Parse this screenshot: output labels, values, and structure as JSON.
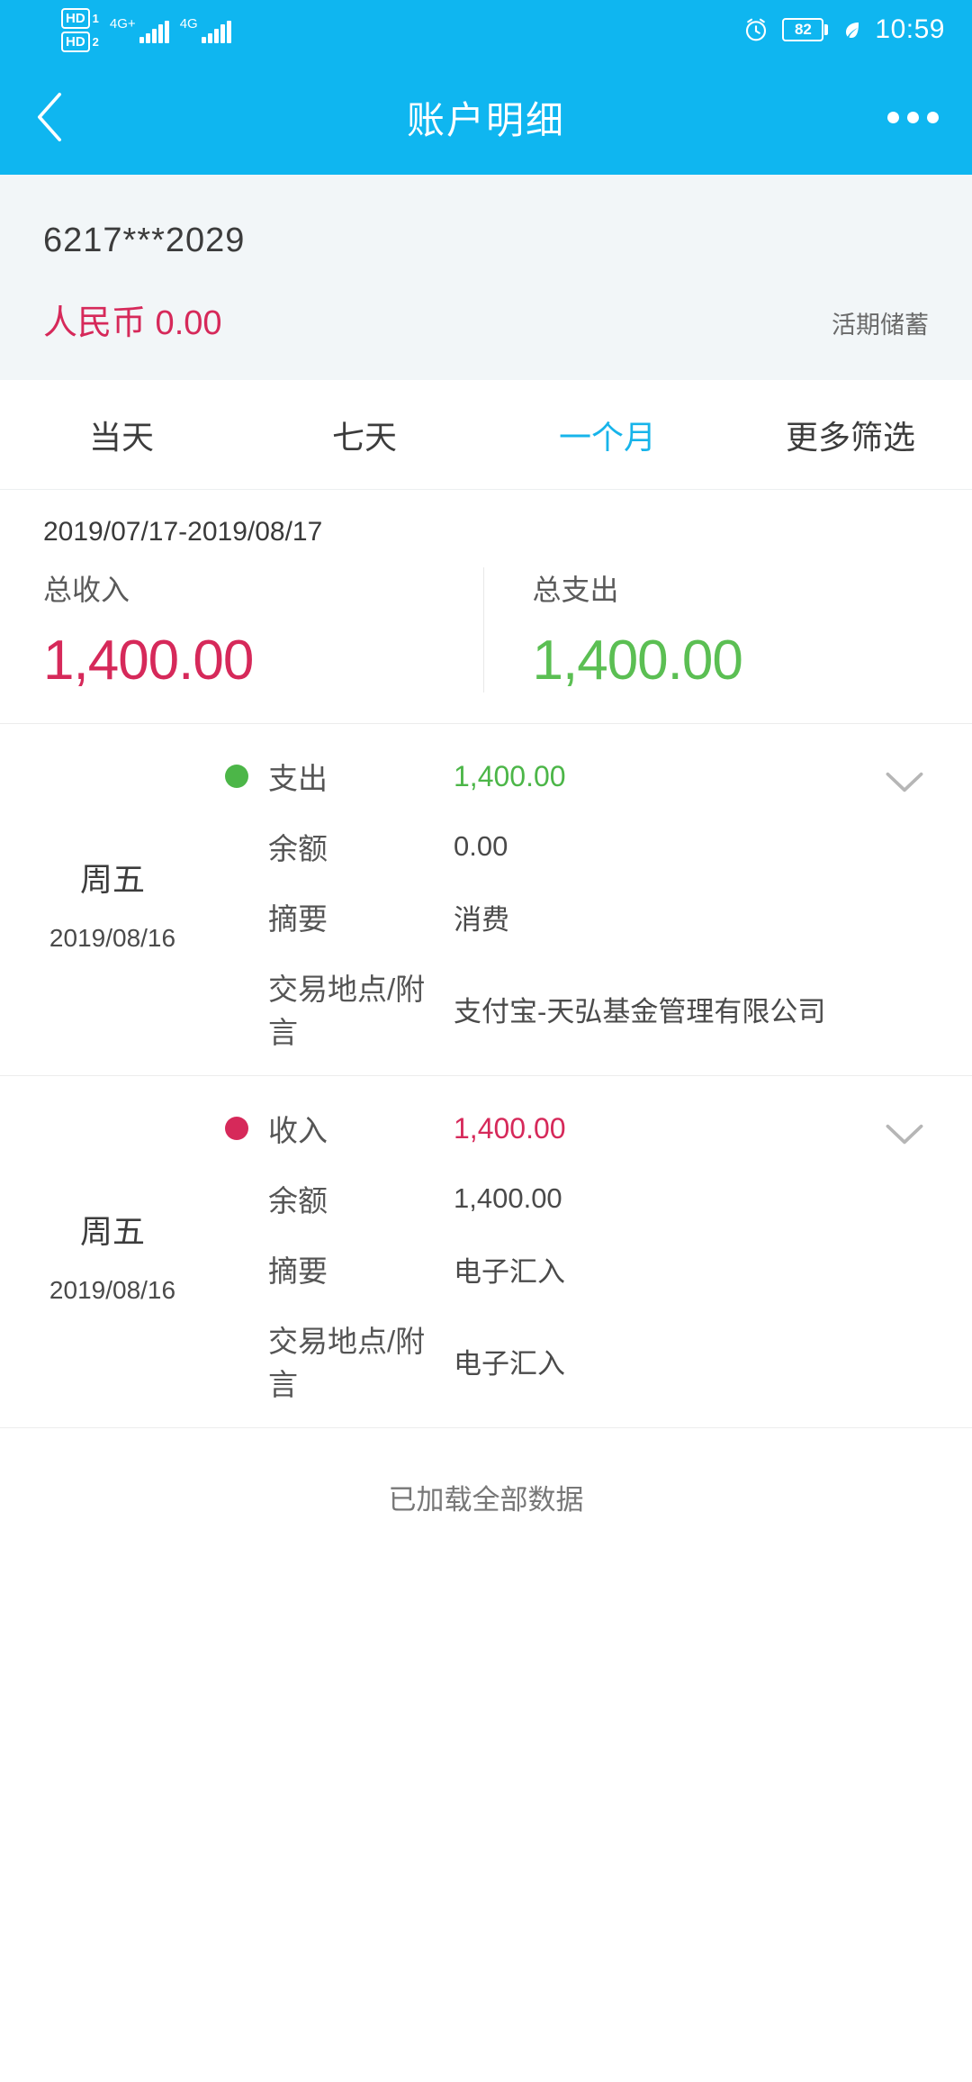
{
  "status_bar": {
    "sim1_hd": "HD",
    "sim1_index": "1",
    "sim2_hd": "HD",
    "sim2_index": "2",
    "network1": "4G+",
    "network2": "4G",
    "battery_percent": "82",
    "time": "10:59",
    "icons": {
      "alarm": "alarm-icon",
      "leaf": "leaf-icon",
      "battery": "battery-icon",
      "signal": "signal-bars-icon"
    }
  },
  "header": {
    "title": "账户明细",
    "back_icon": "back-chevron-icon",
    "more_icon": "more-options-icon"
  },
  "account": {
    "number": "6217***2029",
    "balance": "人民币 0.00",
    "type": "活期储蓄"
  },
  "tabs": [
    {
      "label": "当天",
      "active": false
    },
    {
      "label": "七天",
      "active": false
    },
    {
      "label": "一个月",
      "active": true
    },
    {
      "label": "更多筛选",
      "active": false
    }
  ],
  "summary": {
    "date_range": "2019/07/17-2019/08/17",
    "income_label": "总收入",
    "income_value": "1,400.00",
    "expense_label": "总支出",
    "expense_value": "1,400.00"
  },
  "transactions": [
    {
      "weekday": "周五",
      "date": "2019/08/16",
      "type_label": "支出",
      "type_kind": "expense",
      "amount": "1,400.00",
      "balance_label": "余额",
      "balance_value": "0.00",
      "summary_label": "摘要",
      "summary_value": "消费",
      "place_label": "交易地点/附言",
      "place_value": "支付宝-天弘基金管理有限公司",
      "chevron_icon": "chevron-down-icon"
    },
    {
      "weekday": "周五",
      "date": "2019/08/16",
      "type_label": "收入",
      "type_kind": "income",
      "amount": "1,400.00",
      "balance_label": "余额",
      "balance_value": "1,400.00",
      "summary_label": "摘要",
      "summary_value": "电子汇入",
      "place_label": "交易地点/附言",
      "place_value": "电子汇入",
      "chevron_icon": "chevron-down-icon"
    }
  ],
  "footer": {
    "note": "已加载全部数据"
  },
  "colors": {
    "brand_blue": "#0FB6F0",
    "accent_blue": "#17B4EA",
    "income_pink": "#D6295A",
    "expense_green": "#4CB648",
    "card_bg": "#F2F6F8"
  }
}
